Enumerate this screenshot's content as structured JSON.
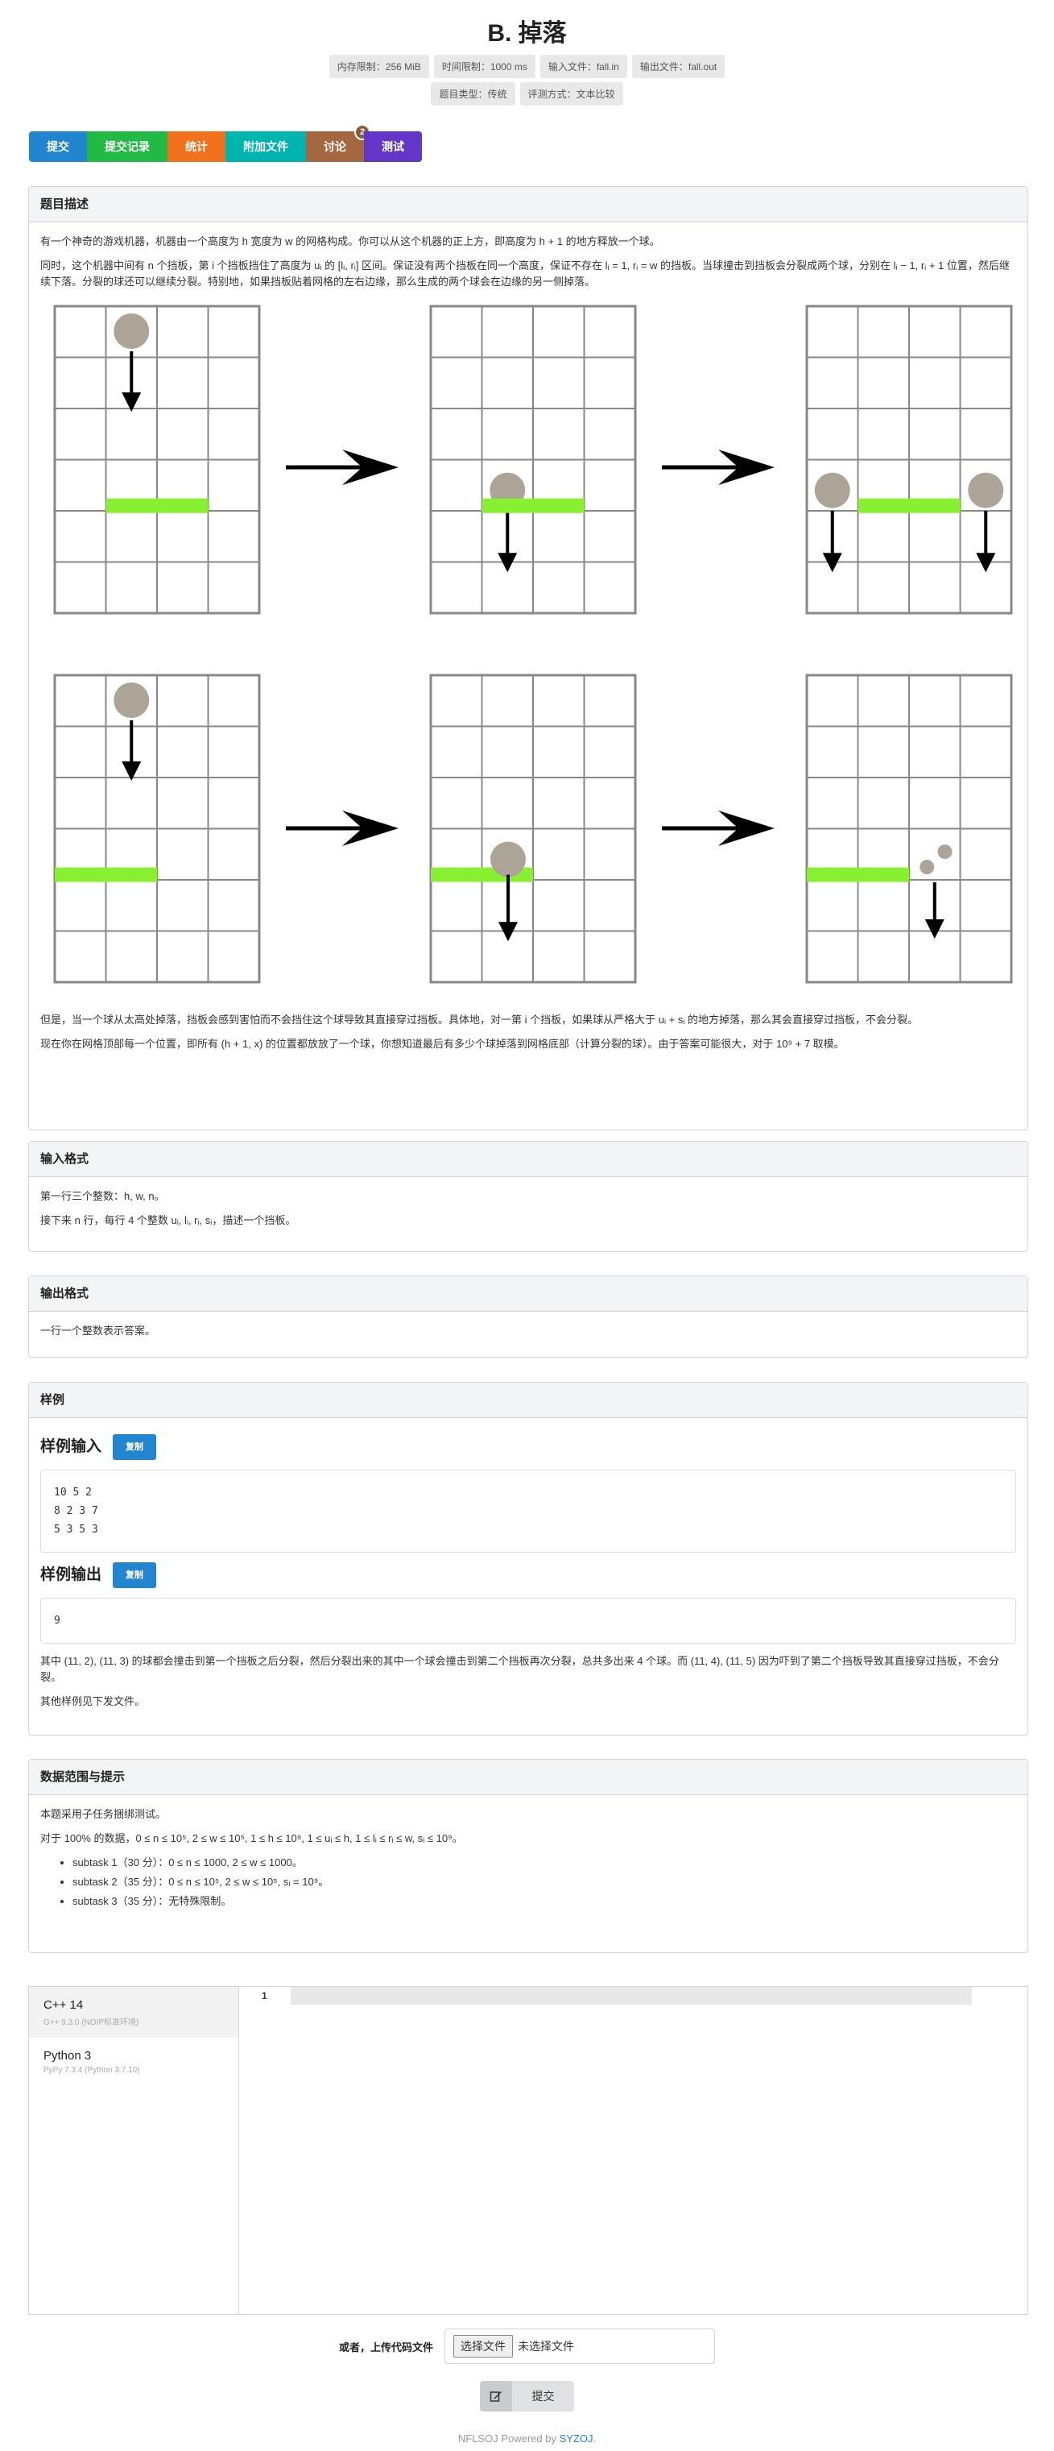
{
  "problem": {
    "title": "B. 掉落",
    "limits_row1": [
      "内存限制：256 MiB",
      "时间限制：1000 ms",
      "输入文件：fall.in",
      "输出文件：fall.out"
    ],
    "limits_row2": [
      "题目类型：传统",
      "评测方式：文本比较"
    ]
  },
  "tabs": [
    {
      "label": "提交",
      "color": "#2185d0"
    },
    {
      "label": "提交记录",
      "color": "#21ba45"
    },
    {
      "label": "统计",
      "color": "#f2711c"
    },
    {
      "label": "附加文件",
      "color": "#00b5ad"
    },
    {
      "label": "讨论",
      "color": "#a5673f",
      "badge": "2"
    },
    {
      "label": "测试",
      "color": "#6435c9"
    }
  ],
  "sections": {
    "description": {
      "heading": "题目描述",
      "p1": "有一个神奇的游戏机器，机器由一个高度为 h 宽度为 w 的网格构成。你可以从这个机器的正上方，即高度为 h + 1 的地方释放一个球。",
      "p2": "同时，这个机器中间有 n 个挡板，第 i 个挡板挡住了高度为 uᵢ 的 [lᵢ, rᵢ] 区间。保证没有两个挡板在同一个高度，保证不存在 lᵢ = 1, rᵢ = w 的挡板。当球撞击到挡板会分裂成两个球，分别在 lᵢ − 1, rᵢ + 1 位置，然后继续下落。分裂的球还可以继续分裂。特别地，如果挡板贴着网格的左右边缘，那么生成的两个球会在边缘的另一侧掉落。",
      "p3": "但是，当一个球从太高处掉落，挡板会感到害怕而不会挡住这个球导致其直接穿过挡板。具体地，对一第 i 个挡板，如果球从严格大于 uᵢ + sᵢ 的地方掉落，那么其会直接穿过挡板，不会分裂。",
      "p4": "现在你在网格顶部每一个位置，即所有 (h + 1, x) 的位置都放放了一个球，你想知道最后有多少个球掉落到网格底部（计算分裂的球）。由于答案可能很大，对于 10⁹ + 7 取模。"
    },
    "input": {
      "heading": "输入格式",
      "p1": "第一行三个整数：h, w, n。",
      "p2": "接下来 n 行，每行 4 个整数 uᵢ, lᵢ, rᵢ, sᵢ，描述一个挡板。"
    },
    "output": {
      "heading": "输出格式",
      "p1": "一行一个整数表示答案。"
    },
    "samples": {
      "heading": "样例",
      "input_title": "样例输入",
      "output_title": "样例输出",
      "copy_label": "复制",
      "input": "10 5 2\n8 2 3 7\n5 3 5 3",
      "output": "9",
      "note": "其中 (11, 2), (11, 3) 的球都会撞击到第一个挡板之后分裂，然后分裂出来的其中一个球会撞击到第二个挡板再次分裂，总共多出来 4 个球。而 (11, 4), (11, 5) 因为吓到了第二个挡板导致其直接穿过挡板，不会分裂。",
      "note2": "其他样例见下发文件。"
    },
    "constraints": {
      "heading": "数据范围与提示",
      "p1": "本题采用子任务捆绑测试。",
      "p2": "对于 100% 的数据，0 ≤ n ≤ 10⁵, 2 ≤ w ≤ 10⁵, 1 ≤ h ≤ 10⁹, 1 ≤ uᵢ ≤ h, 1 ≤ lᵢ ≤ rᵢ ≤ w, sᵢ ≤ 10⁹。",
      "subtasks": [
        "subtask 1（30 分）：0 ≤ n ≤ 1000, 2 ≤ w ≤ 1000。",
        "subtask 2（35 分）：0 ≤ n ≤ 10⁵, 2 ≤ w ≤ 10⁵, sᵢ = 10⁹。",
        "subtask 3（35 分）：无特殊限制。"
      ]
    }
  },
  "editor": {
    "languages": [
      {
        "name": "C++ 14",
        "version": "G++ 9.3.0 (NOIP标准环境)"
      },
      {
        "name": "Python 3",
        "version": "PyPy 7.3.4 (Python 3.7.10)"
      }
    ],
    "line_number": "1"
  },
  "upload": {
    "label": "或者，上传代码文件",
    "file_button": "选择文件",
    "file_status": "未选择文件"
  },
  "submit_label": "提交",
  "footer": {
    "prefix": "NFLSOJ Powered by ",
    "link": "SYZOJ",
    "suffix": "."
  },
  "colors": {
    "board": "#88f030",
    "ball": "#aca497",
    "grid": "#888888"
  }
}
